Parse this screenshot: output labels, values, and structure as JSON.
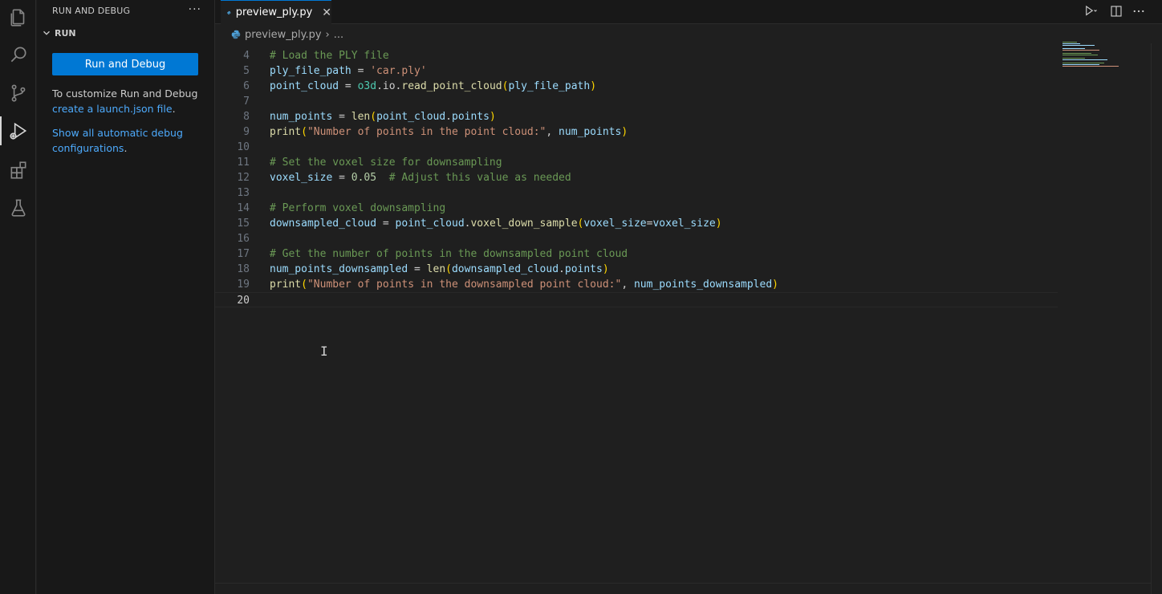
{
  "activity_bar": {
    "icons": [
      "explorer-icon",
      "search-icon",
      "source-control-icon",
      "run-debug-icon",
      "extensions-icon",
      "testing-icon"
    ]
  },
  "sidebar": {
    "title": "RUN AND DEBUG",
    "more": "···",
    "section_title": "RUN",
    "run_button": "Run and Debug",
    "customize_text": "To customize Run and Debug",
    "launch_link": "create a launch.json file",
    "launch_suffix": ".",
    "show_link_line1": "Show all automatic debug",
    "show_link_line2": "configurations",
    "show_suffix": "."
  },
  "editor": {
    "tab_label": "preview_ply.py",
    "tab_close": "✕",
    "breadcrumb_file": "preview_ply.py",
    "breadcrumb_sep": "›",
    "breadcrumb_more": "...",
    "line_numbers": [
      "4",
      "5",
      "6",
      "7",
      "8",
      "9",
      "10",
      "11",
      "12",
      "13",
      "14",
      "15",
      "16",
      "17",
      "18",
      "19",
      "20"
    ],
    "current_line": "20"
  },
  "colors": {
    "accent": "#0078d4",
    "link": "#4daafc",
    "comment": "#6a9955",
    "string": "#ce9178"
  }
}
